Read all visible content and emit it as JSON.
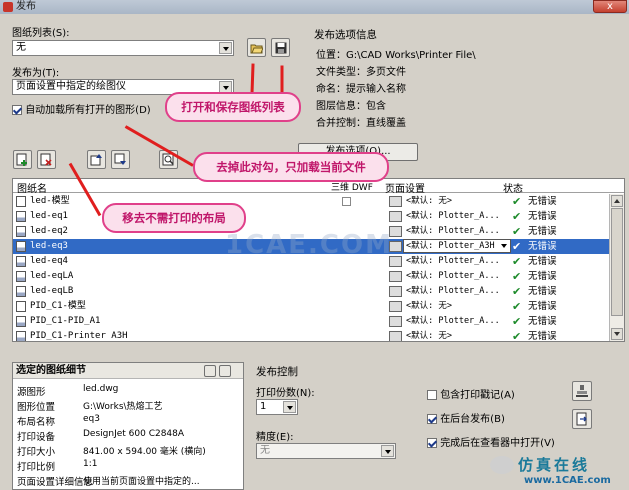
{
  "window": {
    "title": "发布",
    "close_label": "x"
  },
  "sheet_list": {
    "label": "图纸列表(S):",
    "value": "无"
  },
  "publish_to": {
    "label": "发布为(T):",
    "value": "页面设置中指定的绘图仪"
  },
  "auto_load": {
    "label": "自动加载所有打开的图形(D)",
    "checked": true
  },
  "options_info": {
    "title": "发布选项信息",
    "rows": [
      {
        "k": "位置：",
        "v": "G:\\CAD Works\\Printer File\\"
      },
      {
        "k": "文件类型：",
        "v": "多页文件"
      },
      {
        "k": "命名：",
        "v": "提示输入名称"
      },
      {
        "k": "图层信息：",
        "v": "包含"
      },
      {
        "k": "合并控制：",
        "v": "直线覆盖"
      }
    ],
    "button_label": "发布选项(O)..."
  },
  "table": {
    "headers": {
      "name": "图纸名",
      "dwf3d": "三维 DWF",
      "setup": "页面设置",
      "status": "状态"
    },
    "rows": [
      {
        "name": "led-模型",
        "setup": "<默认: 无>",
        "status": "无错误",
        "kind": "model",
        "selected": false
      },
      {
        "name": "led-eq1",
        "setup": "<默认: Plotter_A...",
        "status": "无错误",
        "kind": "layout",
        "selected": false
      },
      {
        "name": "led-eq2",
        "setup": "<默认: Plotter_A...",
        "status": "无错误",
        "kind": "layout",
        "selected": false
      },
      {
        "name": "led-eq3",
        "setup": "<默认: Plotter_A3H",
        "status": "无错误",
        "kind": "layout",
        "selected": true
      },
      {
        "name": "led-eq4",
        "setup": "<默认: Plotter_A...",
        "status": "无错误",
        "kind": "layout",
        "selected": false
      },
      {
        "name": "led-eqLA",
        "setup": "<默认: Plotter_A...",
        "status": "无错误",
        "kind": "layout",
        "selected": false
      },
      {
        "name": "led-eqLB",
        "setup": "<默认: Plotter_A...",
        "status": "无错误",
        "kind": "layout",
        "selected": false
      },
      {
        "name": "PID_C1-模型",
        "setup": "<默认: 无>",
        "status": "无错误",
        "kind": "model",
        "selected": false
      },
      {
        "name": "PID_C1-PID_A1",
        "setup": "<默认: Plotter_A...",
        "status": "无错误",
        "kind": "layout",
        "selected": false
      },
      {
        "name": "PID_C1-Printer A3H",
        "setup": "<默认: 无>",
        "status": "无错误",
        "kind": "layout",
        "selected": false
      }
    ]
  },
  "details": {
    "title": "选定的图纸细节",
    "rows": [
      {
        "k": "源图形",
        "v": "led.dwg"
      },
      {
        "k": "图形位置",
        "v": "G:\\Works\\热熔工艺"
      },
      {
        "k": "布局名称",
        "v": "eq3"
      },
      {
        "k": "打印设备",
        "v": "DesignJet 600 C2848A"
      },
      {
        "k": "打印大小",
        "v": "841.00 x 594.00 毫米 (横向)"
      },
      {
        "k": "打印比例",
        "v": "1:1"
      },
      {
        "k": "页面设置详细信息",
        "v": "使用当前页面设置中指定的..."
      }
    ]
  },
  "publish_control": {
    "title": "发布控制",
    "copies_label": "打印份数(N):",
    "copies_value": "1",
    "precision_label": "精度(E):",
    "precision_value": "无",
    "options": [
      {
        "label": "包含打印戳记(A)",
        "checked": false
      },
      {
        "label": "在后台发布(B)",
        "checked": true
      },
      {
        "label": "完成后在查看器中打开(V)",
        "checked": true
      }
    ]
  },
  "callouts": {
    "open_save": "打开和保存图纸列表",
    "uncheck": "去掉此对勾，只加载当前文件",
    "remove": "移去不需打印的布局"
  },
  "watermark": {
    "center": "1CAE.COM",
    "brand": "仿真在线",
    "site": "www.1CAE.com"
  },
  "colors": {
    "accent_pink": "#e0408a",
    "arrow_red": "#e01e1e",
    "selection": "#316ac5",
    "ok_green": "#1d8a2a"
  }
}
